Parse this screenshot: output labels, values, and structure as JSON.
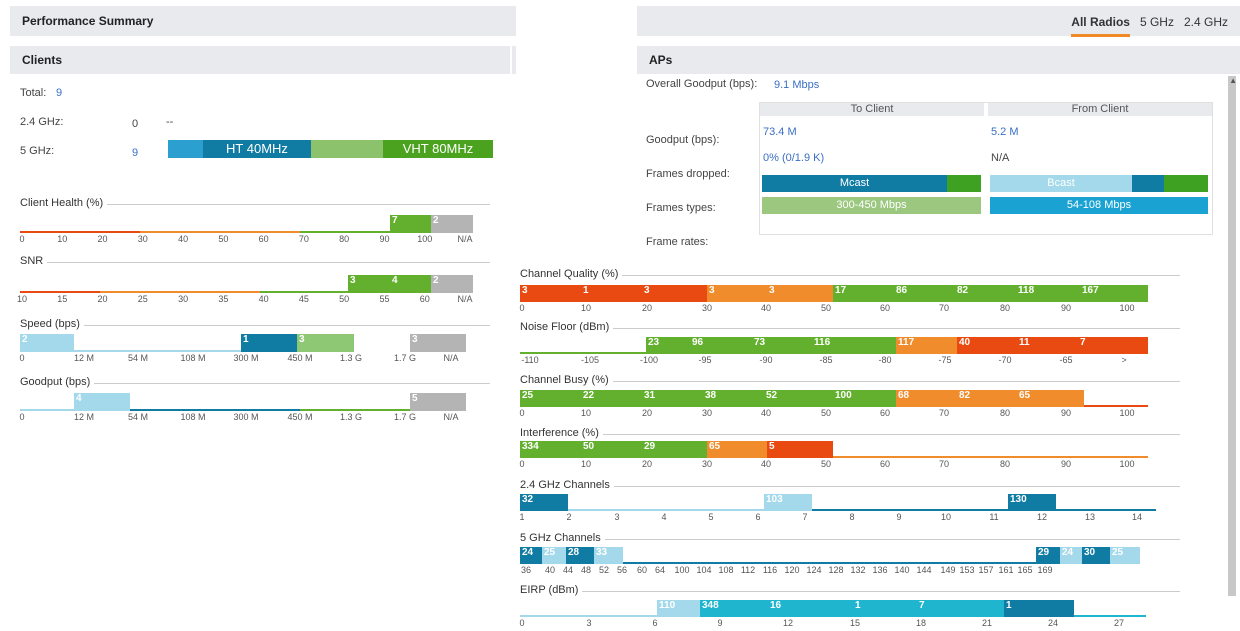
{
  "perf_title": "Performance Summary",
  "clients": {
    "title": "Clients",
    "total_label": "Total:",
    "total": "9",
    "g24_label": "2.4 GHz:",
    "g24_value": "0",
    "g24_extra": "--",
    "g5_label": "5 GHz:",
    "g5_value": "9",
    "ht_label": "HT 40MHz",
    "vht_label": "VHT 80MHz"
  },
  "health": {
    "title": "Client Health (%)",
    "ticks": [
      "0",
      "10",
      "20",
      "30",
      "40",
      "50",
      "60",
      "70",
      "80",
      "90",
      "100",
      "N/A"
    ],
    "segs": [
      "7",
      "2"
    ]
  },
  "snr": {
    "title": "SNR",
    "ticks": [
      "10",
      "15",
      "20",
      "25",
      "30",
      "35",
      "40",
      "45",
      "50",
      "55",
      "60",
      "N/A"
    ],
    "segs": [
      "3",
      "4",
      "2"
    ]
  },
  "speed": {
    "title": "Speed (bps)",
    "ticks": [
      "0",
      "12 M",
      "54 M",
      "108 M",
      "300 M",
      "450 M",
      "1.3 G",
      "1.7 G",
      "N/A"
    ],
    "segs": [
      "2",
      "1",
      "3",
      "3"
    ]
  },
  "goodput": {
    "title": "Goodput (bps)",
    "ticks": [
      "0",
      "12 M",
      "54 M",
      "108 M",
      "300 M",
      "450 M",
      "1.3 G",
      "1.7 G",
      "N/A"
    ],
    "segs": [
      "4",
      "5"
    ]
  },
  "tabs": {
    "all": "All Radios",
    "g5": "5 GHz",
    "g24": "2.4 GHz"
  },
  "aps": {
    "title": "APs",
    "overall_label": "Overall Goodput (bps):",
    "overall_value": "9.1 Mbps",
    "to_client": "To Client",
    "from_client": "From Client",
    "goodput_label": "Goodput (bps):",
    "goodput_to": "73.4 M",
    "goodput_from": "5.2 M",
    "dropped_label": "Frames dropped:",
    "dropped_to": "0% (0/1.9 K)",
    "dropped_from": "N/A",
    "types_label": "Frames types:",
    "mcast": "Mcast",
    "bcast": "Bcast",
    "rates_label": "Frame rates:",
    "rate_to": "300-450 Mbps",
    "rate_from": "54-108 Mbps"
  },
  "chq": {
    "title": "Channel Quality (%)",
    "ticks": [
      "0",
      "10",
      "20",
      "30",
      "40",
      "50",
      "60",
      "70",
      "80",
      "90",
      "100"
    ],
    "segs": [
      "3",
      "1",
      "3",
      "3",
      "3",
      "17",
      "86",
      "82",
      "118",
      "167"
    ]
  },
  "noise": {
    "title": "Noise Floor (dBm)",
    "ticks": [
      "-110",
      "-105",
      "-100",
      "-95",
      "-90",
      "-85",
      "-80",
      "-75",
      "-70",
      "-65",
      ">"
    ],
    "segs": [
      "23",
      "96",
      "73",
      "116",
      "117",
      "40",
      "11",
      "7"
    ]
  },
  "busy": {
    "title": "Channel Busy (%)",
    "ticks": [
      "0",
      "10",
      "20",
      "30",
      "40",
      "50",
      "60",
      "70",
      "80",
      "90",
      "100"
    ],
    "segs": [
      "25",
      "22",
      "31",
      "38",
      "52",
      "100",
      "68",
      "82",
      "65"
    ]
  },
  "intf": {
    "title": "Interference (%)",
    "ticks": [
      "0",
      "10",
      "20",
      "30",
      "40",
      "50",
      "60",
      "70",
      "80",
      "90",
      "100"
    ],
    "segs": [
      "334",
      "50",
      "29",
      "65",
      "5"
    ]
  },
  "ch24": {
    "title": "2.4 GHz Channels",
    "ticks": [
      "1",
      "2",
      "3",
      "4",
      "5",
      "6",
      "7",
      "8",
      "9",
      "10",
      "11",
      "12",
      "13",
      "14"
    ],
    "segs": [
      "32",
      "103",
      "130"
    ]
  },
  "ch5": {
    "title": "5 GHz Channels",
    "ticks": [
      "36",
      "40",
      "44",
      "48",
      "52",
      "56",
      "60",
      "64",
      "100",
      "104",
      "108",
      "112",
      "116",
      "120",
      "124",
      "128",
      "132",
      "136",
      "140",
      "144",
      "149",
      "153",
      "157",
      "161",
      "165",
      "169"
    ],
    "segs": [
      "24",
      "25",
      "28",
      "33",
      "29",
      "24",
      "30",
      "25"
    ]
  },
  "eirp": {
    "title": "EIRP (dBm)",
    "ticks": [
      "0",
      "3",
      "6",
      "9",
      "12",
      "15",
      "18",
      "21",
      "24",
      "27"
    ],
    "segs": [
      "110",
      "348",
      "16",
      "1",
      "7",
      "1"
    ]
  }
}
